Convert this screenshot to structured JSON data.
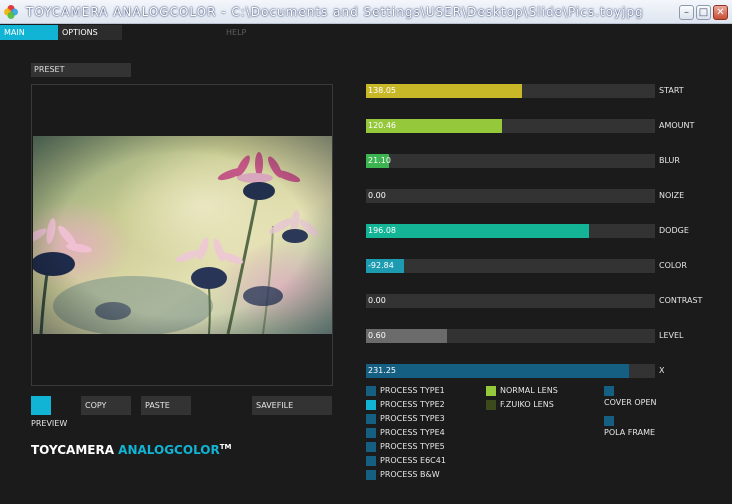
{
  "window": {
    "title": "TOYCAMERA ANALOGCOLOR - C:\\Documents and Settings\\USER\\Desktop\\Slide\\Pics.toyjpg",
    "minimize_symbol": "–",
    "maximize_symbol": "□",
    "close_symbol": "✕"
  },
  "menu": {
    "main": "MAIN",
    "options": "OPTIONS",
    "help": "HELP"
  },
  "preset_label": "PRESET",
  "buttons": {
    "preview": "PREVIEW",
    "copy": "COPY",
    "paste": "PASTE",
    "savefile": "SAVEFILE"
  },
  "brand": {
    "part1": "TOYCAMERA ",
    "part2": "ANALOGCOLOR",
    "tm": "TM"
  },
  "sliders": [
    {
      "label": "START",
      "value": "138.05",
      "fill": 0.54,
      "color": "#c8b828"
    },
    {
      "label": "AMOUNT",
      "value": "120.46",
      "fill": 0.47,
      "color": "#96c83c"
    },
    {
      "label": "BLUR",
      "value": "21.10",
      "fill": 0.08,
      "color": "#3cb450"
    },
    {
      "label": "NOIZE",
      "value": "0.00",
      "fill": 0.0,
      "color": "#11b4d4"
    },
    {
      "label": "DODGE",
      "value": "196.08",
      "fill": 0.77,
      "color": "#14b496"
    },
    {
      "label": "COLOR",
      "value": "-92.84",
      "fill": 0.13,
      "color": "#1d9bb0"
    },
    {
      "label": "CONTRAST",
      "value": "0.00",
      "fill": 0.0,
      "color": "#11b4d4"
    },
    {
      "label": "LEVEL",
      "value": "0.60",
      "fill": 0.28,
      "color": "#6b6b6b"
    },
    {
      "label": "X",
      "value": "231.25",
      "fill": 0.91,
      "color": "#155f82"
    }
  ],
  "process_types": [
    {
      "label": "PROCESS TYPE1",
      "active": false
    },
    {
      "label": "PROCESS TYPE2",
      "active": true
    },
    {
      "label": "PROCESS TYPE3",
      "active": false
    },
    {
      "label": "PROCESS TYPE4",
      "active": false
    },
    {
      "label": "PROCESS TYPE5",
      "active": false
    },
    {
      "label": "PROCESS E6C41",
      "active": false
    },
    {
      "label": "PROCESS B&W",
      "active": false
    }
  ],
  "lenses": [
    {
      "label": "NORMAL LENS",
      "active": true
    },
    {
      "label": "F.ZUIKO LENS",
      "active": false
    }
  ],
  "frame_options": [
    {
      "label": "COVER OPEN",
      "active": false
    },
    {
      "label": "POLA FRAME",
      "active": false
    }
  ],
  "colors": {
    "accent": "#11b4d4",
    "panel_bg": "#1b1b1b",
    "control_bg": "#333333",
    "checkbox_off": "#155f82",
    "checkbox_on": "#11b4d4",
    "lens_on": "#96c83c",
    "lens_off": "#3c4a1e"
  }
}
